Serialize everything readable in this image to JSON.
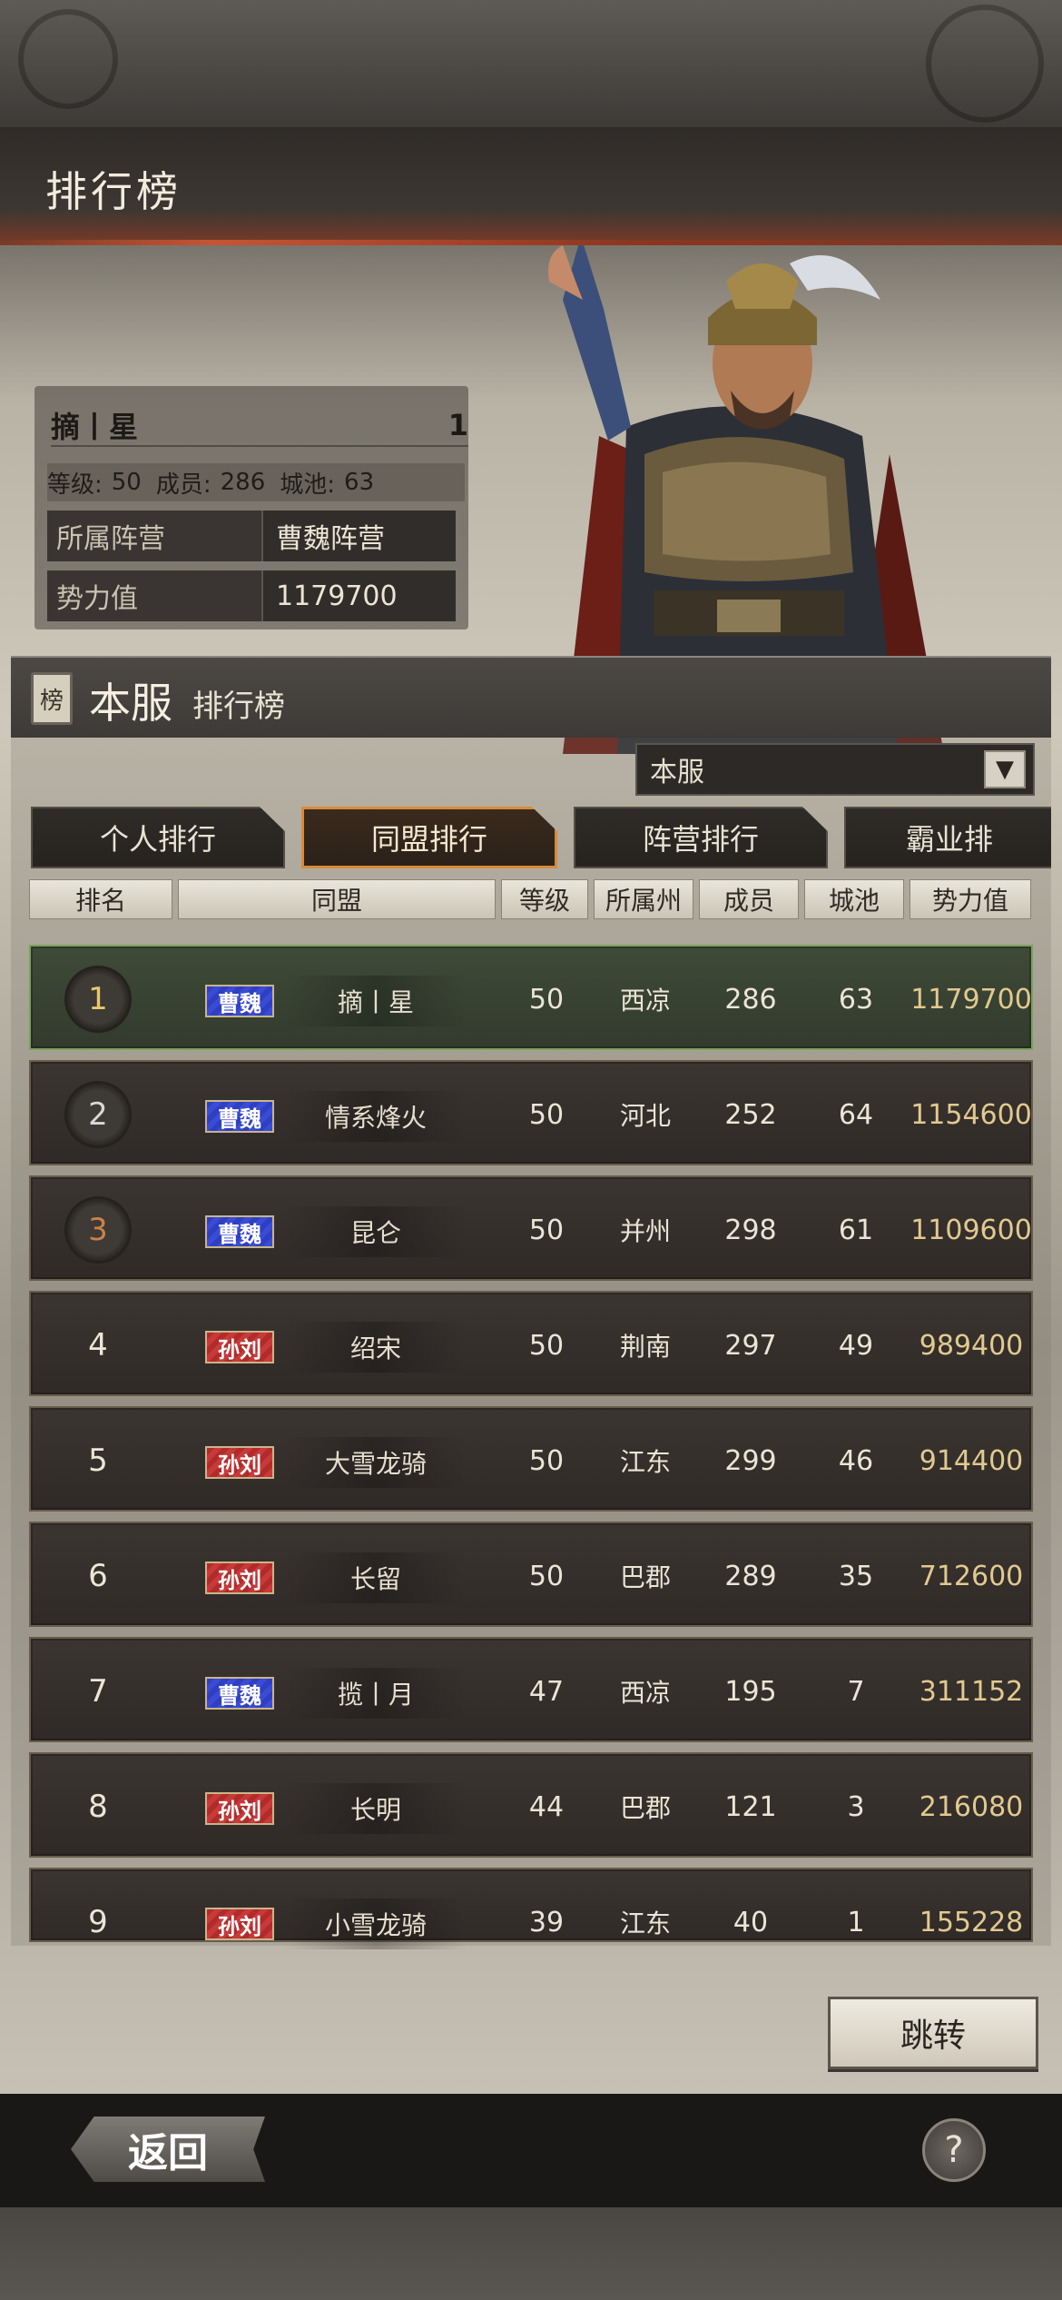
{
  "page_title": "排行榜",
  "alliance_card": {
    "name": "摘丨星",
    "rank": "1",
    "level_label": "等级:",
    "level": "50",
    "members_label": "成员:",
    "members": "286",
    "cities_label": "城池:",
    "cities": "63",
    "faction_label": "所属阵营",
    "faction": "曹魏阵营",
    "power_label": "势力值",
    "power": "1179700"
  },
  "section": {
    "icon_char": "榜",
    "title": "本服",
    "subtitle": "排行榜"
  },
  "server_dropdown": {
    "value": "本服"
  },
  "tabs": [
    {
      "label": "个人排行",
      "active": false
    },
    {
      "label": "同盟排行",
      "active": true
    },
    {
      "label": "阵营排行",
      "active": false
    },
    {
      "label": "霸业排",
      "active": false
    }
  ],
  "columns": [
    "排名",
    "同盟",
    "等级",
    "所属州",
    "成员",
    "城池",
    "势力值"
  ],
  "rows": [
    {
      "rank": "1",
      "faction": "曹魏",
      "name": "摘丨星",
      "level": "50",
      "region": "西凉",
      "members": "286",
      "cities": "63",
      "power": "1179700"
    },
    {
      "rank": "2",
      "faction": "曹魏",
      "name": "情系烽火",
      "level": "50",
      "region": "河北",
      "members": "252",
      "cities": "64",
      "power": "1154600"
    },
    {
      "rank": "3",
      "faction": "曹魏",
      "name": "昆仑",
      "level": "50",
      "region": "并州",
      "members": "298",
      "cities": "61",
      "power": "1109600"
    },
    {
      "rank": "4",
      "faction": "孙刘",
      "name": "绍宋",
      "level": "50",
      "region": "荆南",
      "members": "297",
      "cities": "49",
      "power": "989400"
    },
    {
      "rank": "5",
      "faction": "孙刘",
      "name": "大雪龙骑",
      "level": "50",
      "region": "江东",
      "members": "299",
      "cities": "46",
      "power": "914400"
    },
    {
      "rank": "6",
      "faction": "孙刘",
      "name": "长留",
      "level": "50",
      "region": "巴郡",
      "members": "289",
      "cities": "35",
      "power": "712600"
    },
    {
      "rank": "7",
      "faction": "曹魏",
      "name": "揽丨月",
      "level": "47",
      "region": "西凉",
      "members": "195",
      "cities": "7",
      "power": "311152"
    },
    {
      "rank": "8",
      "faction": "孙刘",
      "name": "长明",
      "level": "44",
      "region": "巴郡",
      "members": "121",
      "cities": "3",
      "power": "216080"
    },
    {
      "rank": "9",
      "faction": "孙刘",
      "name": "小雪龙骑",
      "level": "39",
      "region": "江东",
      "members": "40",
      "cities": "1",
      "power": "155228"
    }
  ],
  "jump_button": "跳转",
  "back_button": "返回",
  "help_button": "?"
}
